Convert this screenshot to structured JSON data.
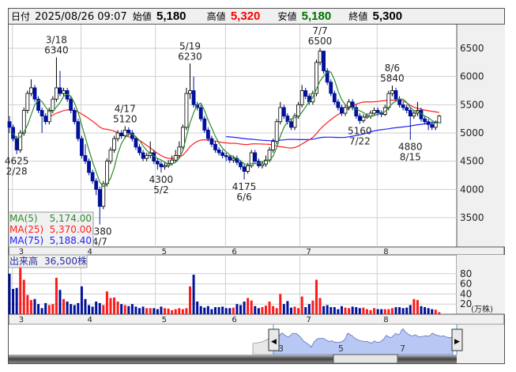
{
  "header": {
    "date_label": "日付",
    "datetime": "2025/08/26 09:07",
    "open_label": "始値",
    "open": "5,180",
    "high_label": "高値",
    "high": "5,320",
    "low_label": "安値",
    "low": "5,180",
    "close_label": "終値",
    "close": "5,300"
  },
  "colors": {
    "up_body": "#ffffff",
    "down_body": "#00129a",
    "volume_up": "#ff1a1a",
    "volume_down": "#00129a",
    "ma5": "#2e8b2e",
    "ma25": "#ff2020",
    "ma75": "#2020ff",
    "high_text": "#ff0000",
    "low_text": "#007000",
    "navigator_fill": "#b8c8f4"
  },
  "legend": {
    "ma5": {
      "label": "MA(5)",
      "value": "5,174.00"
    },
    "ma25": {
      "label": "MA(25)",
      "value": "5,370.00"
    },
    "ma75": {
      "label": "MA(75)",
      "value": "5,188.40"
    }
  },
  "volume_panel": {
    "label": "出来高",
    "value": "36,500株",
    "unit": "(万株)",
    "ticks": [
      "20",
      "40",
      "60",
      "80"
    ]
  },
  "navigator": {
    "labels": [
      "3",
      "5",
      "7"
    ],
    "left_handle": "◀",
    "right_handle": "▶"
  },
  "chart_data": {
    "type": "candlestick",
    "price_axis": {
      "ticks": [
        3500,
        4000,
        4500,
        5000,
        5500,
        6000,
        6500
      ],
      "range": [
        2980,
        6930
      ]
    },
    "volume_axis": {
      "ticks": [
        20,
        40,
        60,
        80
      ],
      "unit": "万株"
    },
    "month_ticks": [
      {
        "label": "3",
        "i": 3
      },
      {
        "label": "4",
        "i": 22
      },
      {
        "label": "5",
        "i": 42.6
      },
      {
        "label": "6",
        "i": 62
      },
      {
        "label": "7",
        "i": 82.6
      },
      {
        "label": "8",
        "i": 104
      }
    ],
    "annotations": [
      {
        "date": "2/28",
        "value": "4625",
        "i": 2,
        "pos": "below"
      },
      {
        "date": "3/18",
        "value": "6340",
        "i": 13,
        "pos": "above"
      },
      {
        "date": "4/7",
        "value": "3380",
        "i": 25,
        "pos": "below"
      },
      {
        "date": "4/17",
        "value": "5120",
        "i": 32,
        "pos": "above"
      },
      {
        "date": "5/2",
        "value": "4300",
        "i": 42,
        "pos": "below"
      },
      {
        "date": "5/19",
        "value": "6230",
        "i": 50,
        "pos": "above"
      },
      {
        "date": "6/6",
        "value": "4175",
        "i": 65,
        "pos": "below"
      },
      {
        "date": "7/7",
        "value": "6500",
        "i": 86,
        "pos": "above"
      },
      {
        "date": "7/22",
        "value": "5160",
        "i": 97,
        "pos": "below"
      },
      {
        "date": "8/6",
        "value": "5840",
        "i": 106,
        "pos": "above"
      },
      {
        "date": "8/15",
        "value": "4880",
        "i": 111,
        "pos": "below"
      }
    ],
    "ohlc": [
      [
        5200,
        5300,
        5000,
        5100
      ],
      [
        5100,
        5150,
        4850,
        4900
      ],
      [
        4900,
        4950,
        4625,
        4700
      ],
      [
        4700,
        5050,
        4650,
        5000
      ],
      [
        5000,
        5450,
        4950,
        5400
      ],
      [
        5400,
        5750,
        5350,
        5700
      ],
      [
        5700,
        5950,
        5650,
        5800
      ],
      [
        5800,
        5850,
        5550,
        5600
      ],
      [
        5600,
        5650,
        5350,
        5400
      ],
      [
        5400,
        5450,
        5000,
        5300
      ],
      [
        5300,
        5350,
        5150,
        5200
      ],
      [
        5200,
        5450,
        5150,
        5400
      ],
      [
        5400,
        5650,
        5350,
        5600
      ],
      [
        5600,
        6340,
        5550,
        5800
      ],
      [
        5800,
        6100,
        5650,
        5700
      ],
      [
        5700,
        5800,
        5650,
        5750
      ],
      [
        5750,
        5800,
        5550,
        5600
      ],
      [
        5600,
        5650,
        5350,
        5400
      ],
      [
        5400,
        5450,
        5150,
        5200
      ],
      [
        5200,
        5250,
        4850,
        4900
      ],
      [
        4900,
        4950,
        4550,
        4600
      ],
      [
        4600,
        4800,
        4450,
        4500
      ],
      [
        4500,
        4550,
        4250,
        4300
      ],
      [
        4300,
        4350,
        4100,
        4150
      ],
      [
        4150,
        4200,
        3900,
        4000
      ],
      [
        4000,
        4050,
        3380,
        3700
      ],
      [
        3700,
        4150,
        3650,
        4100
      ],
      [
        4100,
        4550,
        4050,
        4500
      ],
      [
        4500,
        4750,
        4450,
        4700
      ],
      [
        4700,
        4950,
        4650,
        4900
      ],
      [
        4900,
        5050,
        4850,
        5000
      ],
      [
        5000,
        5050,
        4900,
        4950
      ],
      [
        4950,
        5120,
        4900,
        5050
      ],
      [
        5050,
        5100,
        4950,
        5000
      ],
      [
        5000,
        5050,
        4850,
        4900
      ],
      [
        4900,
        4950,
        4700,
        4750
      ],
      [
        4750,
        4800,
        4600,
        4650
      ],
      [
        4650,
        4700,
        4500,
        4550
      ],
      [
        4550,
        4650,
        4500,
        4600
      ],
      [
        4600,
        4850,
        4550,
        4650
      ],
      [
        4650,
        4700,
        4450,
        4500
      ],
      [
        4500,
        4550,
        4350,
        4450
      ],
      [
        4450,
        4500,
        4300,
        4400
      ],
      [
        4400,
        4480,
        4350,
        4420
      ],
      [
        4420,
        4520,
        4380,
        4460
      ],
      [
        4460,
        4600,
        4420,
        4520
      ],
      [
        4520,
        4700,
        4480,
        4600
      ],
      [
        4600,
        4850,
        4550,
        4750
      ],
      [
        4750,
        5150,
        4700,
        5100
      ],
      [
        5100,
        5800,
        5050,
        5700
      ],
      [
        5700,
        6230,
        5600,
        5750
      ],
      [
        5750,
        6000,
        5450,
        5500
      ],
      [
        5500,
        5550,
        5400,
        5450
      ],
      [
        5450,
        5500,
        5200,
        5250
      ],
      [
        5250,
        5300,
        5000,
        5050
      ],
      [
        5050,
        5100,
        4850,
        4900
      ],
      [
        4900,
        4950,
        4750,
        4800
      ],
      [
        4800,
        4850,
        4650,
        4700
      ],
      [
        4700,
        4750,
        4600,
        4650
      ],
      [
        4650,
        4700,
        4550,
        4600
      ],
      [
        4600,
        4650,
        4500,
        4580
      ],
      [
        4580,
        4620,
        4470,
        4520
      ],
      [
        4520,
        4600,
        4470,
        4550
      ],
      [
        4550,
        4600,
        4430,
        4480
      ],
      [
        4480,
        4520,
        4350,
        4400
      ],
      [
        4400,
        4450,
        4175,
        4320
      ],
      [
        4320,
        4470,
        4280,
        4420
      ],
      [
        4420,
        4700,
        4380,
        4650
      ],
      [
        4650,
        4700,
        4450,
        4500
      ],
      [
        4500,
        4550,
        4380,
        4420
      ],
      [
        4420,
        4500,
        4370,
        4450
      ],
      [
        4450,
        4600,
        4400,
        4520
      ],
      [
        4520,
        4750,
        4480,
        4700
      ],
      [
        4700,
        4900,
        4650,
        4850
      ],
      [
        4850,
        5250,
        4800,
        5200
      ],
      [
        5200,
        5550,
        5150,
        5450
      ],
      [
        5450,
        5500,
        5250,
        5300
      ],
      [
        5300,
        5350,
        5150,
        5200
      ],
      [
        5200,
        5250,
        5050,
        5100
      ],
      [
        5100,
        5350,
        5050,
        5300
      ],
      [
        5300,
        5550,
        5250,
        5500
      ],
      [
        5500,
        5850,
        5450,
        5750
      ],
      [
        5750,
        5800,
        5600,
        5650
      ],
      [
        5650,
        5700,
        5500,
        5550
      ],
      [
        5550,
        5750,
        5500,
        5700
      ],
      [
        5700,
        6300,
        5650,
        6250
      ],
      [
        6250,
        6500,
        6200,
        6450
      ],
      [
        6450,
        6450,
        6050,
        6100
      ],
      [
        6100,
        6150,
        5850,
        5900
      ],
      [
        5900,
        5950,
        5650,
        5700
      ],
      [
        5700,
        5750,
        5500,
        5550
      ],
      [
        5550,
        5600,
        5400,
        5450
      ],
      [
        5450,
        5500,
        5300,
        5350
      ],
      [
        5350,
        5500,
        5300,
        5450
      ],
      [
        5450,
        5600,
        5400,
        5550
      ],
      [
        5550,
        5600,
        5400,
        5450
      ],
      [
        5450,
        5500,
        5250,
        5300
      ],
      [
        5300,
        5350,
        5160,
        5220
      ],
      [
        5220,
        5330,
        5180,
        5280
      ],
      [
        5280,
        5350,
        5250,
        5300
      ],
      [
        5300,
        5400,
        5250,
        5350
      ],
      [
        5350,
        5450,
        5300,
        5400
      ],
      [
        5400,
        5450,
        5300,
        5360
      ],
      [
        5360,
        5400,
        5280,
        5330
      ],
      [
        5330,
        5500,
        5300,
        5450
      ],
      [
        5450,
        5750,
        5400,
        5700
      ],
      [
        5700,
        5840,
        5650,
        5750
      ],
      [
        5750,
        5800,
        5550,
        5600
      ],
      [
        5600,
        5650,
        5450,
        5500
      ],
      [
        5500,
        5550,
        5400,
        5450
      ],
      [
        5450,
        5500,
        5350,
        5400
      ],
      [
        5400,
        5450,
        4880,
        5300
      ],
      [
        5300,
        5400,
        5250,
        5350
      ],
      [
        5350,
        5550,
        5300,
        5400
      ],
      [
        5400,
        5450,
        5200,
        5250
      ],
      [
        5250,
        5300,
        5150,
        5200
      ],
      [
        5200,
        5250,
        5050,
        5150
      ],
      [
        5150,
        5200,
        5050,
        5100
      ],
      [
        5100,
        5220,
        5050,
        5180
      ],
      [
        5180,
        5320,
        5180,
        5300
      ]
    ],
    "volume": [
      80,
      50,
      52,
      98,
      68,
      38,
      28,
      30,
      20,
      12,
      22,
      18,
      20,
      72,
      48,
      30,
      25,
      20,
      18,
      22,
      55,
      30,
      18,
      15,
      25,
      22,
      18,
      45,
      32,
      33,
      25,
      20,
      18,
      16,
      20,
      15,
      12,
      15,
      12,
      12,
      12,
      10,
      15,
      12,
      11,
      8,
      10,
      12,
      10,
      12,
      55,
      78,
      25,
      16,
      13,
      16,
      10,
      14,
      14,
      15,
      12,
      12,
      13,
      20,
      18,
      25,
      32,
      27,
      16,
      12,
      14,
      17,
      25,
      16,
      12,
      40,
      20,
      26,
      13,
      15,
      12,
      35,
      14,
      20,
      27,
      68,
      32,
      16,
      18,
      14,
      14,
      10,
      16,
      13,
      12,
      15,
      14,
      12,
      13,
      10,
      8,
      12,
      10,
      10,
      10,
      10,
      12,
      14,
      14,
      12,
      13,
      18,
      30,
      28,
      16,
      14,
      12,
      10,
      9,
      4
    ]
  }
}
